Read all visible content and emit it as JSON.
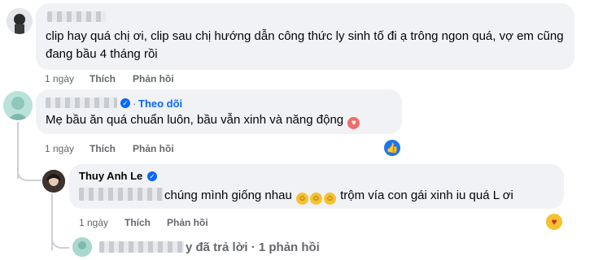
{
  "comments": [
    {
      "text": "clip hay quá chị ơi, clip sau chị hướng dẫn công thức ly sinh tố đi ạ trông ngon quá, vợ em cũng đang bầu 4 tháng rồi",
      "time": "1 ngày",
      "like_label": "Thích",
      "reply_label": "Phản hồi"
    },
    {
      "follow_label": "Theo dõi",
      "text": "Mẹ bầu ăn quá chuẩn luôn, bầu vẫn xinh và năng động",
      "time": "1 ngày",
      "like_label": "Thích",
      "reply_label": "Phản hồi",
      "reaction_icon": "like-icon"
    }
  ],
  "reply": {
    "author": "Thuy Anh Le",
    "text_before_emoji": "chúng mình giống nhau",
    "text_after_emoji": "trộm vía con gái xinh iu quá L ơi",
    "time": "1 ngày",
    "like_label": "Thích",
    "reply_label": "Phản hồi",
    "reaction_icon": "care-icon"
  },
  "more_replies": "y đã trả lời · 1 phản hồi",
  "colors": {
    "bubble": "#f0f2f5",
    "link": "#0866ff",
    "muted": "#65676b"
  }
}
